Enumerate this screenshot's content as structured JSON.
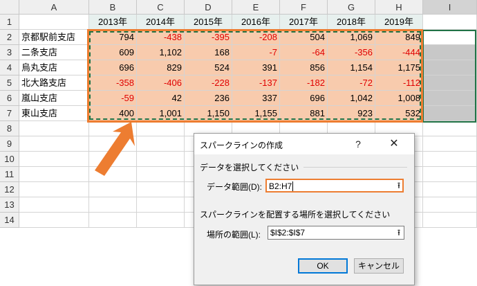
{
  "columns": [
    "A",
    "B",
    "C",
    "D",
    "E",
    "F",
    "G",
    "H",
    "I"
  ],
  "rows": [
    "1",
    "2",
    "3",
    "4",
    "5",
    "6",
    "7",
    "8",
    "9",
    "10",
    "11",
    "12",
    "13",
    "14"
  ],
  "years": [
    "2013年",
    "2014年",
    "2015年",
    "2016年",
    "2017年",
    "2018年",
    "2019年"
  ],
  "branches": [
    {
      "name": "京都駅前支店",
      "values": [
        "794",
        "-438",
        "-395",
        "-208",
        "504",
        "1,069",
        "849"
      ]
    },
    {
      "name": "二条支店",
      "values": [
        "609",
        "1,102",
        "168",
        "-7",
        "-64",
        "-356",
        "-444"
      ]
    },
    {
      "name": "烏丸支店",
      "values": [
        "696",
        "829",
        "524",
        "391",
        "856",
        "1,154",
        "1,175"
      ]
    },
    {
      "name": "北大路支店",
      "values": [
        "-358",
        "-406",
        "-228",
        "-137",
        "-182",
        "-72",
        "-112"
      ]
    },
    {
      "name": "嵐山支店",
      "values": [
        "-59",
        "42",
        "236",
        "337",
        "696",
        "1,042",
        "1,008"
      ]
    },
    {
      "name": "東山支店",
      "values": [
        "400",
        "1,001",
        "1,150",
        "1,155",
        "881",
        "923",
        "532"
      ]
    }
  ],
  "colors": {
    "highlight": "#f8cbad",
    "negative": "#e00000",
    "orange": "#ed7d31",
    "selection": "#217346"
  },
  "dialog": {
    "title": "スパークラインの作成",
    "help": "?",
    "close": "✕",
    "section1": "データを選択してください",
    "data_range_label": "データ範囲(D):",
    "data_range_value": "B2:H7",
    "section2": "スパークラインを配置する場所を選択してください",
    "location_label": "場所の範囲(L):",
    "location_value": "$I$2:$I$7",
    "collapse_icon": "⭱",
    "ok": "OK",
    "cancel": "キャンセル"
  }
}
